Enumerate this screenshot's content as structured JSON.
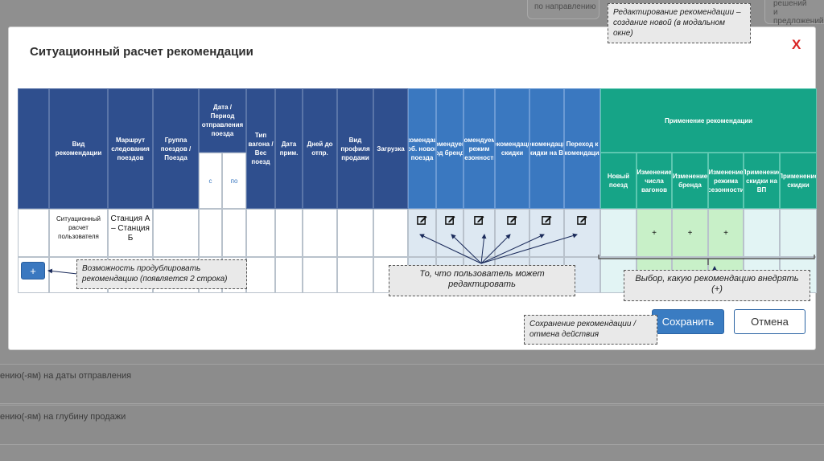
{
  "background": {
    "top_box_text": "по направлению",
    "top_right_line1": "решений",
    "top_right_line2": "и предложений",
    "row1": "ению(-ям) на даты отправления",
    "row2": "ению(-ям) на глубину продажи"
  },
  "modal": {
    "title": "Ситуационный расчет рекомендации",
    "close": "X"
  },
  "headers": {
    "col_type": "Вид рекомендации",
    "col_route": "Маршрут следования поездов",
    "col_group": "Группа поездов / Поезда",
    "col_date": "Дата / Период отправления поезда",
    "col_date_from": "с",
    "col_date_to": "по",
    "col_wagon": "Тип вагона / Вес поезд",
    "col_date_prim": "Дата прим.",
    "col_days": "Дней до отпр.",
    "col_profile": "Вид профиля продажи",
    "col_load": "Загрузка",
    "col_rec_new": "Рекомендация доб. нового поезда",
    "col_rec_brand": "Рекомендуемый код бренда",
    "col_rec_season": "Рекомендуемый режим сезонности",
    "col_rec_discount": "Рекомендация скидки",
    "col_rec_vp": "Рекомендация скидки на ВП",
    "col_transition": "Переход к рекомендациям",
    "apply_group": "Применение рекомендации",
    "apply_new_train": "Новый поезд",
    "apply_count": "Изменение числа вагонов",
    "apply_brand": "Изменение бренда",
    "apply_season": "Изменение режима сезонности",
    "apply_vp": "Применение скидки на ВП",
    "apply_discount": "Применение скидки"
  },
  "row": {
    "type": "Ситуационный расчет пользователя",
    "route": "Станция А – Станция Б",
    "plus_count": "+",
    "plus_brand": "+",
    "plus_season": "+"
  },
  "icons": [
    "edit-icon",
    "edit-icon",
    "edit-icon",
    "edit-icon",
    "edit-icon",
    "edit-icon"
  ],
  "buttons": {
    "add": "+",
    "save": "Сохранить",
    "cancel": "Отмена"
  },
  "callouts": {
    "top": "Редактирование рекомендации – создание новой (в модальном окне)",
    "duplicate": "Возможность продублировать рекомендацию (появляется 2 строка)",
    "edit": "То, что пользователь может редактировать",
    "choose": "Выбор, какую рекомендацию внедрять (+)",
    "save": "Сохранение рекомендации / отмена действия"
  },
  "colors": {
    "dark_header": "#2f4f8e",
    "blue_header": "#3a78c0",
    "green_header": "#16a487",
    "close": "#d92525"
  }
}
